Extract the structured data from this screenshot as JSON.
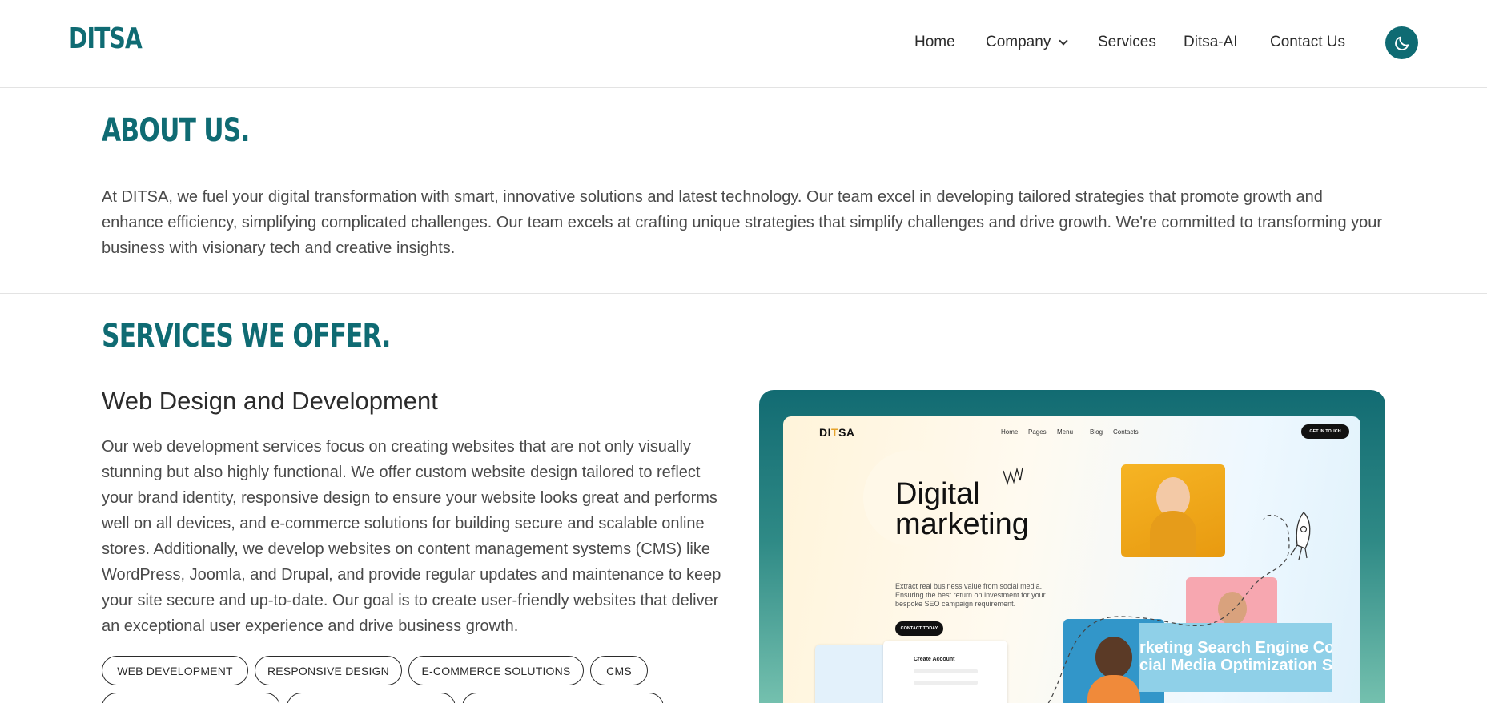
{
  "header": {
    "logo": "DITSA",
    "nav": [
      {
        "label": "Home"
      },
      {
        "label": "Company"
      },
      {
        "label": "Services"
      },
      {
        "label": "Ditsa-AI"
      },
      {
        "label": "Contact Us"
      }
    ],
    "theme_icon": "moon-icon"
  },
  "about": {
    "title": "ABOUT US.",
    "text": "At DITSA, we fuel your digital transformation with smart, innovative solutions and latest technology. Our team excel in developing tailored strategies that promote growth and enhance efficiency, simplifying complicated challenges. Our team excels at crafting unique strategies that simplify challenges and drive growth. We're committed to transforming your business with visionary tech and creative insights."
  },
  "services": {
    "title": "SERVICES WE OFFER.",
    "item_title": "Web Design and Development",
    "item_text": "Our web development services focus on creating websites that are not only visually stunning but also highly functional. We offer custom website design tailored to reflect your brand identity, responsive design to ensure your website looks great and performs well on all devices, and e-commerce solutions for building secure and scalable online stores. Additionally, we develop websites on content management systems (CMS) like WordPress, Joomla, and Drupal, and provide regular updates and maintenance to keep your site secure and up-to-date. Our goal is to create user-friendly websites that deliver an exceptional user experience and drive business growth.",
    "tags": [
      "WEB DEVELOPMENT",
      "RESPONSIVE DESIGN",
      "E-COMMERCE SOLUTIONS",
      "CMS"
    ]
  },
  "preview": {
    "logo_a": "DI",
    "logo_b": "T",
    "logo_c": "SA",
    "nav": [
      "Home",
      "Pages",
      "Menu",
      "Blog",
      "Contacts"
    ],
    "cta": "GET IN TOUCH",
    "headline_1": "Digital",
    "headline_2": "marketing",
    "paragraph": "Extract real business value from social media. Ensuring the best return on investment for your bespoke SEO campaign requirement.",
    "button": "CONTACT TODAY",
    "marquee_1": "rketing Search Engine Co",
    "marquee_2": "cial Media Optimization S",
    "mini_title": "Create Account"
  },
  "colors": {
    "brand": "#0f6b73",
    "text": "#4a4a4a",
    "border": "#e3e3e3"
  }
}
